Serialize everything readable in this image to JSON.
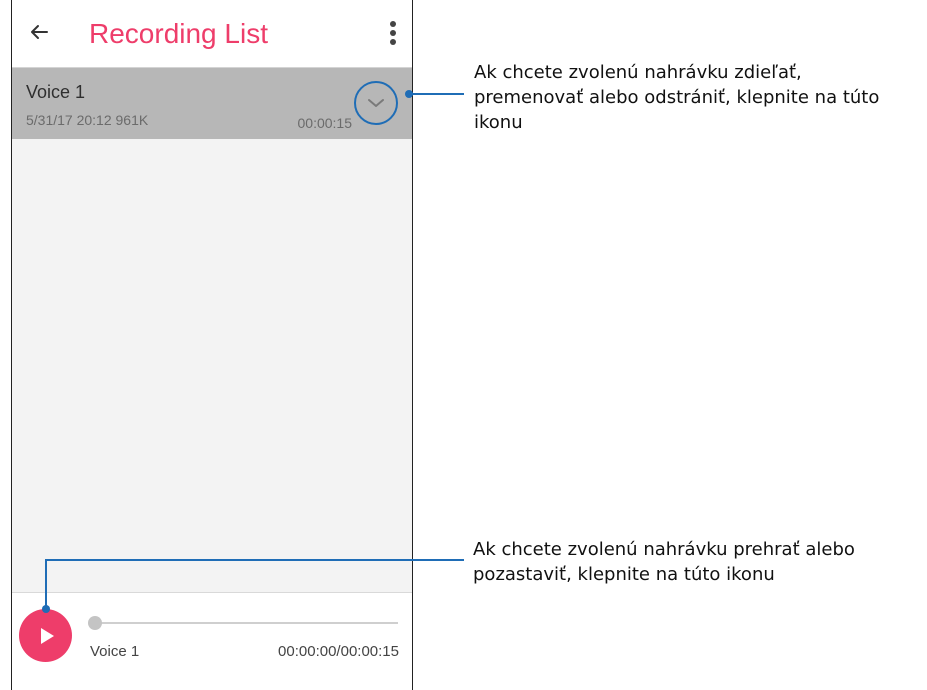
{
  "header": {
    "title": "Recording List",
    "back_icon": "arrow-left-icon",
    "more_icon": "more-vertical-icon"
  },
  "recording": {
    "name": "Voice 1",
    "meta": "5/31/17 20:12  961K",
    "duration": "00:00:15",
    "expand_icon": "chevron-down-icon"
  },
  "player": {
    "play_icon": "play-icon",
    "name": "Voice 1",
    "time": "00:00:00/00:00:15",
    "progress": 0
  },
  "callouts": {
    "options": {
      "line1": "Ak chcete zvolenú nahrávku zdieľať,",
      "line2": "premenovať alebo odstrániť, klepnite na túto",
      "line3": "ikonu"
    },
    "play": {
      "line1": "Ak chcete zvolenú nahrávku prehrať alebo",
      "line2": "pozastaviť, klepnite na túto ikonu"
    }
  },
  "colors": {
    "accent": "#ee3d6a",
    "callout_line": "#1f6db6",
    "selected_row": "#b7b7b7"
  }
}
